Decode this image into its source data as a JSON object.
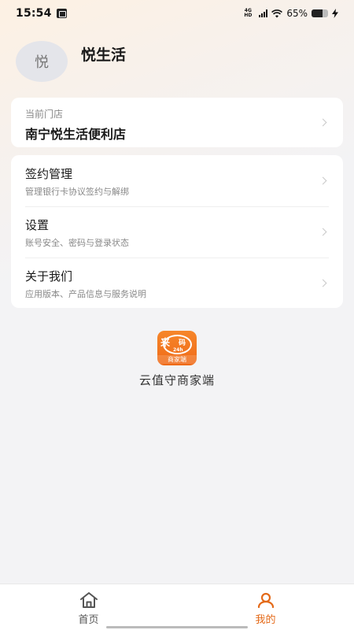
{
  "status_bar": {
    "time": "15:54",
    "network_type": "4G HD",
    "battery_percent_text": "65%",
    "battery_level": 0.65
  },
  "profile": {
    "avatar_text": "悦",
    "name": "悦生活"
  },
  "store": {
    "label": "当前门店",
    "name": "南宁悦生活便利店"
  },
  "menu": [
    {
      "title": "签约管理",
      "desc": "管理银行卡协议签约与解绑"
    },
    {
      "title": "设置",
      "desc": "账号安全、密码与登录状态"
    },
    {
      "title": "关于我们",
      "desc": "应用版本、产品信息与服务说明"
    }
  ],
  "brand": {
    "logo_main": "来",
    "logo_code": "码",
    "logo_hours": "24h",
    "logo_sub": "商家端",
    "name": "云值守商家端"
  },
  "bottom_nav": {
    "home_label": "首页",
    "mine_label": "我的",
    "active": "mine",
    "accent_color": "#e46a19"
  }
}
